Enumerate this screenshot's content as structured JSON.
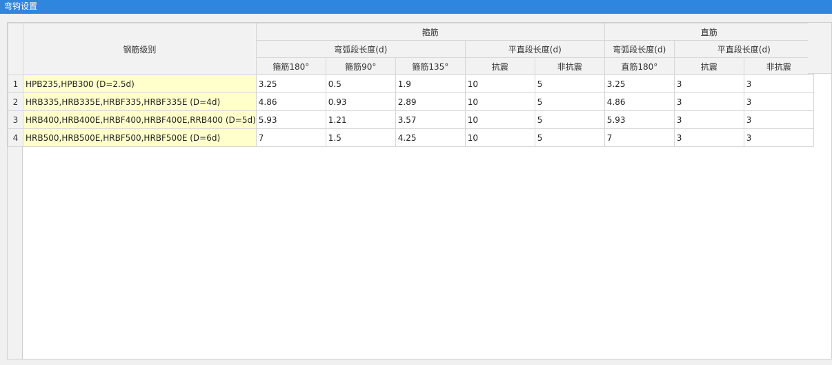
{
  "window": {
    "title": "弯钩设置"
  },
  "table": {
    "grade_header": "钢筋级别",
    "group_stirrup": "箍筋",
    "group_straight": "直筋",
    "sub_arc_length": "弯弧段长度(d)",
    "sub_straight_length": "平直段长度(d)",
    "col_stirrup_180": "箍筋180°",
    "col_stirrup_90": "箍筋90°",
    "col_stirrup_135": "箍筋135°",
    "col_seismic": "抗震",
    "col_nonseismic": "非抗震",
    "col_straight_180": "直筋180°",
    "rows": [
      {
        "num": "1",
        "grade": "HPB235,HPB300 (D=2.5d)",
        "s180": "3.25",
        "s90": "0.5",
        "s135": "1.9",
        "s_seismic": "10",
        "s_nonseismic": "5",
        "z180": "3.25",
        "z_seismic": "3",
        "z_nonseismic": "3"
      },
      {
        "num": "2",
        "grade": "HRB335,HRB335E,HRBF335,HRBF335E (D=4d)",
        "s180": "4.86",
        "s90": "0.93",
        "s135": "2.89",
        "s_seismic": "10",
        "s_nonseismic": "5",
        "z180": "4.86",
        "z_seismic": "3",
        "z_nonseismic": "3"
      },
      {
        "num": "3",
        "grade": "HRB400,HRB400E,HRBF400,HRBF400E,RRB400 (D=5d)",
        "s180": "5.93",
        "s90": "1.21",
        "s135": "3.57",
        "s_seismic": "10",
        "s_nonseismic": "5",
        "z180": "5.93",
        "z_seismic": "3",
        "z_nonseismic": "3"
      },
      {
        "num": "4",
        "grade": "HRB500,HRB500E,HRBF500,HRBF500E (D=6d)",
        "s180": "7",
        "s90": "1.5",
        "s135": "4.25",
        "s_seismic": "10",
        "s_nonseismic": "5",
        "z180": "7",
        "z_seismic": "3",
        "z_nonseismic": "3"
      }
    ]
  },
  "colors": {
    "titlebar": "#2e86de",
    "grade_cell": "#ffffcc",
    "header_bg": "#f2f2f2"
  }
}
